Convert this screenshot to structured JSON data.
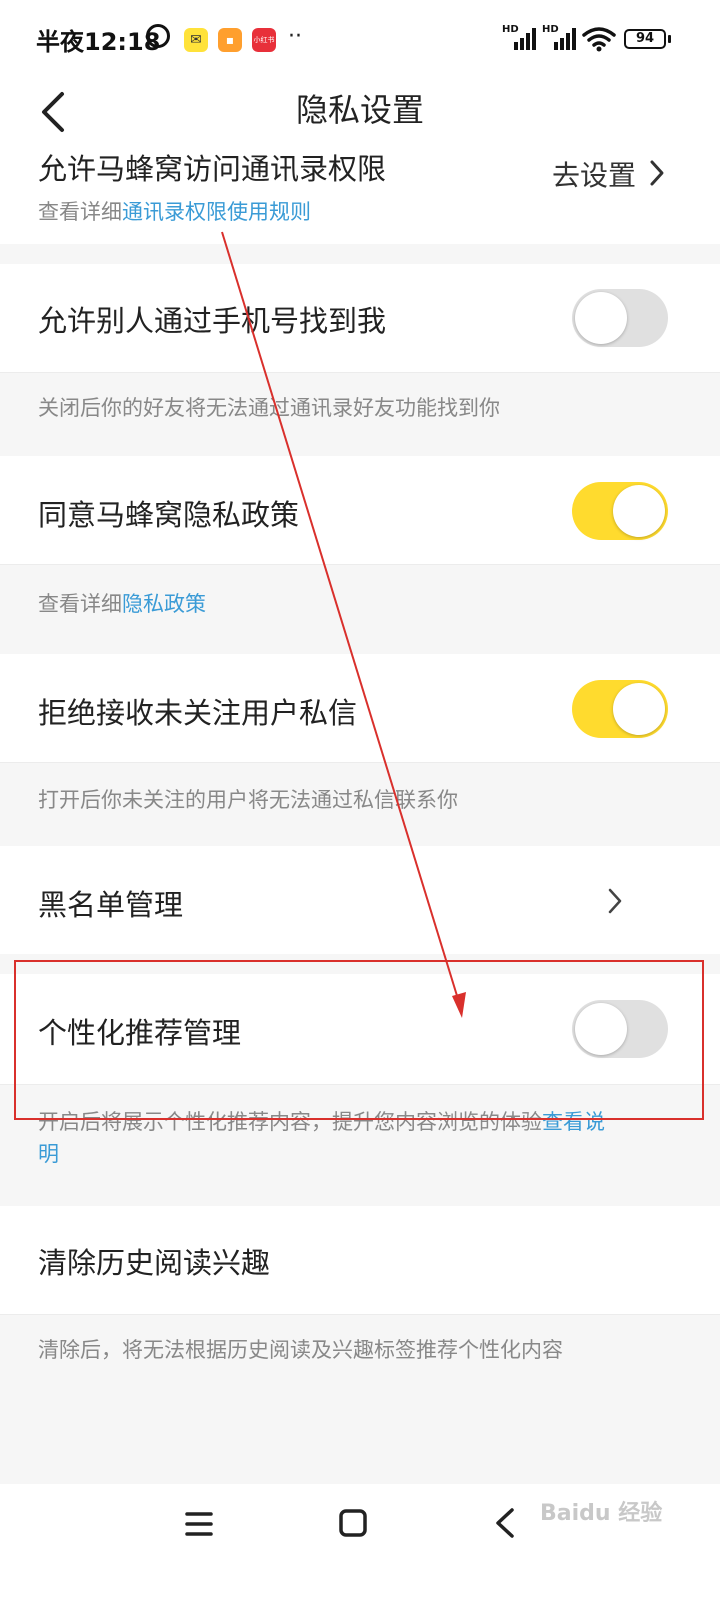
{
  "status_bar": {
    "time": "半夜12:18",
    "app_icons": [
      "alarm-icon",
      "mail-app-icon",
      "notes-app-icon",
      "xiaohongshu-app-icon"
    ],
    "more": "··",
    "hd1": "HD",
    "hd2": "HD",
    "battery": "94"
  },
  "header": {
    "title": "隐私设置"
  },
  "contacts_permission": {
    "title": "允许马蜂窝访问通讯录权限",
    "sub_prefix": "查看详细",
    "sub_link": "通讯录权限使用规则",
    "action": "去设置"
  },
  "find_by_phone": {
    "title": "允许别人通过手机号找到我",
    "on": false,
    "note": "关闭后你的好友将无法通过通讯录好友功能找到你"
  },
  "privacy_policy": {
    "title": "同意马蜂窝隐私政策",
    "on": true,
    "note_prefix": "查看详细",
    "note_link": "隐私政策"
  },
  "reject_messages": {
    "title": "拒绝接收未关注用户私信",
    "on": true,
    "note": "打开后你未关注的用户将无法通过私信联系你"
  },
  "blacklist": {
    "title": "黑名单管理"
  },
  "personalized": {
    "title": "个性化推荐管理",
    "on": false,
    "note_text": "开启后将展示个性化推荐内容，提升您内容浏览的体验",
    "note_link_1": "查看说",
    "note_link_2": "明"
  },
  "clear_history": {
    "title": "清除历史阅读兴趣",
    "note": "清除后，将无法根据历史阅读及兴趣标签推荐个性化内容"
  },
  "colors": {
    "toggle_on": "#ffdb2e",
    "link": "#3a9bd6",
    "annotation": "#d9302c"
  },
  "watermark": "Baidu 经验"
}
